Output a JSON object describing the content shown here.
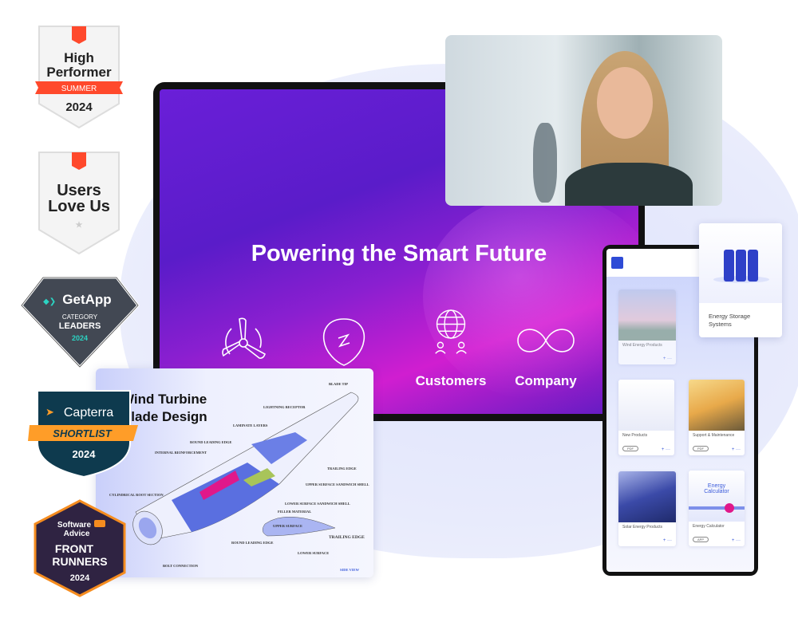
{
  "monitor": {
    "title": "Powering the Smart Future",
    "icons": [
      "turbine-icon",
      "bolt-icon",
      "globe-icon",
      "infinity-icon"
    ],
    "labels": [
      "",
      "",
      "Customers",
      "Company"
    ]
  },
  "tablet": {
    "cards": [
      {
        "title": "Wind Energy Products",
        "pill": ""
      },
      {
        "title": "New Products",
        "pill": "PDF"
      },
      {
        "title": "Support & Maintenance",
        "pill": "PDF"
      },
      {
        "title": "Solar Energy Products",
        "pill": ""
      },
      {
        "title": "Energy Calculator",
        "pill": "APP",
        "hero": "Energy Calculator"
      }
    ],
    "more": "···",
    "add": "+"
  },
  "storage_card": {
    "title": "Energy Storage Systems"
  },
  "diagram": {
    "title_line1": "Wind Turbine",
    "title_line2": "Blade Design",
    "labels": {
      "blade_tip": "BLADE TIP",
      "lightning": "LIGHTNING RECEPTOR",
      "laminate": "LAMINATE LAYERS",
      "round_edge": "ROUND LEADING EDGE",
      "internal": "INTERNAL REINFORCEMENT",
      "trailing": "TRAILING EDGE",
      "upper_shell": "UPPER SURFACE SANDWICH SHELL",
      "lower_shell": "LOWER SURFACE SANDWICH SHELL",
      "filler": "FILLER MATERIAL",
      "root": "CYLINDRICAL ROOT SECTION",
      "upper_surface": "UPPER SURFACE",
      "trailing2": "TRAILING EDGE",
      "round2": "ROUND LEADING EDGE",
      "lower_surface": "LOWER SURFACE",
      "bolt": "BOLT CONNECTION",
      "side_view": "SIDE VIEW"
    }
  },
  "badges": {
    "g2_high": {
      "l1": "High",
      "l2": "Performer",
      "ribbon": "SUMMER",
      "year": "2024"
    },
    "g2_love": {
      "l1": "Users",
      "l2": "Love Us"
    },
    "getapp": {
      "brand": "GetApp",
      "l1": "CATEGORY",
      "l2": "LEADERS",
      "year": "2024"
    },
    "capterra": {
      "brand": "Capterra",
      "ribbon": "SHORTLIST",
      "year": "2024"
    },
    "software_advice": {
      "brand1": "Software",
      "brand2": "Advice",
      "l1": "FRONT",
      "l2": "RUNNERS",
      "year": "2024"
    }
  },
  "colors": {
    "accent": "#2e4bd6",
    "g2": "#ff492c",
    "getapp": "#2bd4c3",
    "capterra": "#ff9d28",
    "sa": "#f58c1f",
    "pink": "#e0188a"
  }
}
